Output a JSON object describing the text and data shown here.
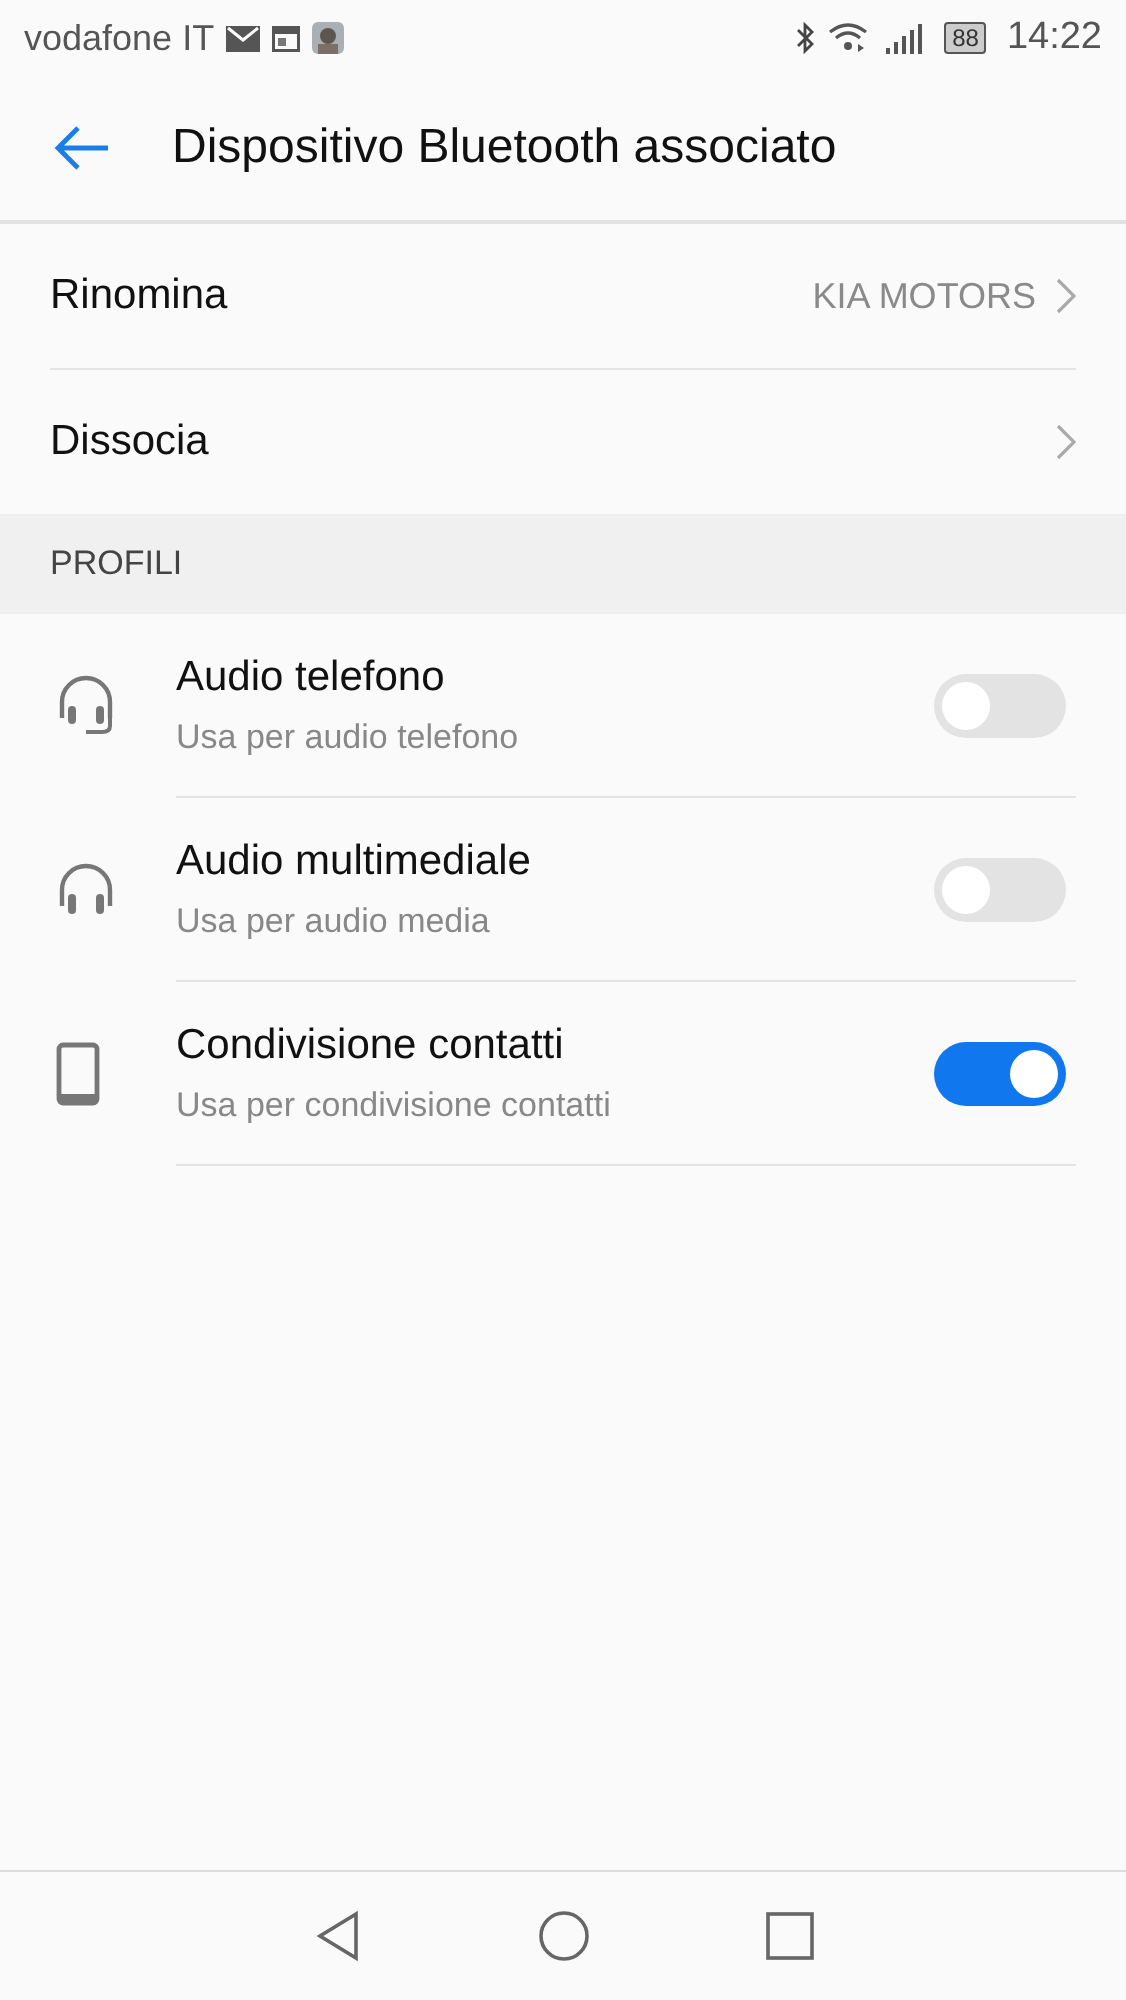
{
  "status_bar": {
    "carrier": "vodafone IT",
    "battery": "88",
    "time": "14:22"
  },
  "header": {
    "title": "Dispositivo Bluetooth associato"
  },
  "settings": [
    {
      "label": "Rinomina",
      "value": "KIA MOTORS"
    },
    {
      "label": "Dissocia"
    }
  ],
  "section": {
    "title": "PROFILI"
  },
  "profiles": [
    {
      "kind": "headset",
      "title": "Audio telefono",
      "subtitle": "Usa per audio telefono",
      "on": false
    },
    {
      "kind": "headphones",
      "title": "Audio multimediale",
      "subtitle": "Usa per audio media",
      "on": false
    },
    {
      "kind": "phone",
      "title": "Condivisione contatti",
      "subtitle": "Usa per condivisione contatti",
      "on": true
    }
  ]
}
